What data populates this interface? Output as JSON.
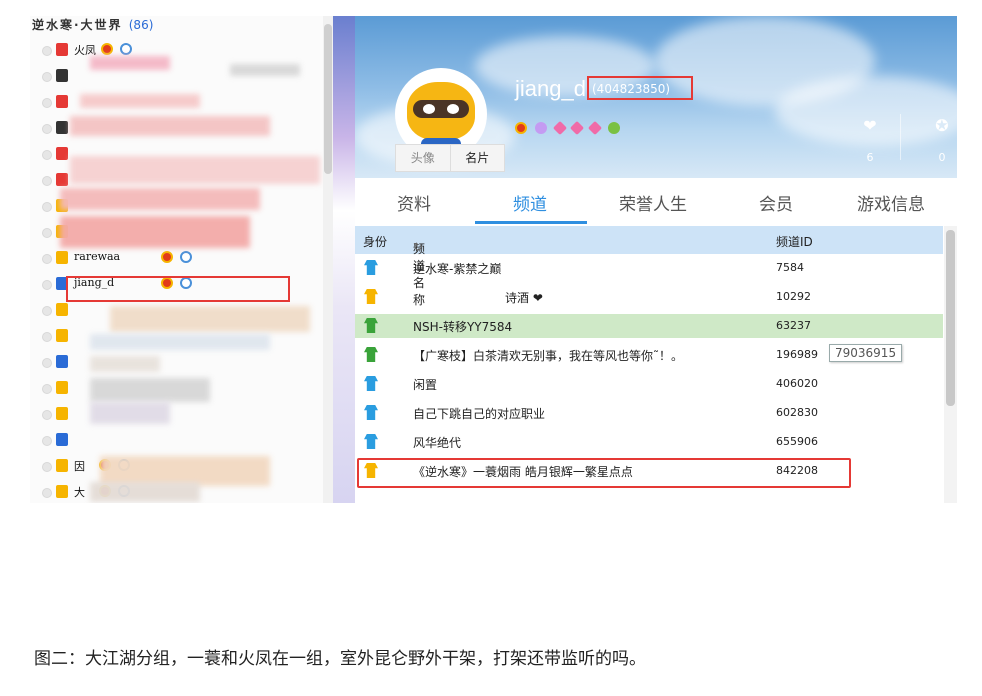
{
  "left_panel": {
    "group_title": "逆水寒·大世界",
    "group_count": "(86)",
    "members": [
      {
        "name": "火凤",
        "icon_color": "#e53935"
      },
      {
        "name": "",
        "icon_color": "#333333"
      },
      {
        "name": "",
        "icon_color": "#e53935"
      },
      {
        "name": "",
        "icon_color": "#333333"
      },
      {
        "name": "",
        "icon_color": "#e53935"
      },
      {
        "name": "",
        "icon_color": "#e53935"
      },
      {
        "name": "",
        "icon_color": "#f6b400"
      },
      {
        "name": "",
        "icon_color": "#f6b400"
      },
      {
        "name": "rarewaa",
        "icon_color": "#f6b400"
      },
      {
        "name": "jiang_d",
        "icon_color": "#2a6bd6"
      },
      {
        "name": "",
        "icon_color": "#f6b400"
      },
      {
        "name": "",
        "icon_color": "#f6b400"
      },
      {
        "name": "",
        "icon_color": "#2a6bd6"
      },
      {
        "name": "",
        "icon_color": "#f6b400"
      },
      {
        "name": "",
        "icon_color": "#f6b400"
      },
      {
        "name": "",
        "icon_color": "#2a6bd6"
      },
      {
        "name": "因",
        "icon_color": "#f6b400"
      },
      {
        "name": "大",
        "icon_color": "#f6b400"
      }
    ]
  },
  "profile": {
    "nickname": "jiang_d",
    "uid": "(404823850)",
    "avatar_tabs": [
      "头像",
      "名片"
    ],
    "stats": [
      {
        "icon": "heart-icon",
        "glyph": "❤",
        "value": "6"
      },
      {
        "icon": "ribbon-icon",
        "glyph": "✪",
        "value": "0"
      }
    ]
  },
  "tabs": [
    "资料",
    "频道",
    "荣誉人生",
    "会员",
    "游戏信息"
  ],
  "active_tab": "频道",
  "table": {
    "headers": {
      "role": "身份",
      "name": "频道名称",
      "id": "频道ID"
    },
    "rows": [
      {
        "name": "逆水寒-紫禁之巅",
        "id": "7584",
        "role_color": "#2a9de0"
      },
      {
        "name": "诗酒 ❤",
        "id": "10292",
        "role_color": "#f6b400"
      },
      {
        "name": "NSH-转移YY7584",
        "id": "63237",
        "role_color": "#3aa33a"
      },
      {
        "name": "【广寒枝】白茶清欢无别事，我在等风也等你˜！。",
        "id": "196989",
        "role_color": "#3aa33a"
      },
      {
        "name": "闲置",
        "id": "406020",
        "role_color": "#2a9de0"
      },
      {
        "name": "自己下跳自己的对应职业",
        "id": "602830",
        "role_color": "#2a9de0"
      },
      {
        "name": "风华绝代",
        "id": "655906",
        "role_color": "#2a9de0"
      },
      {
        "name": "《逆水寒》一蓑烟雨 皓月银辉一繁星点点",
        "id": "842208",
        "role_color": "#f6b400"
      }
    ],
    "tooltip": "79036915"
  },
  "caption": "图二：大江湖分组，一蓑和火凤在一组，室外昆仑野外干架，打架还带监听的吗。",
  "colors": {
    "highlight_red": "#e53935",
    "tab_accent": "#2f8fe0",
    "header_bg": "#cde3f7",
    "selected_row": "#cfe9c7"
  }
}
